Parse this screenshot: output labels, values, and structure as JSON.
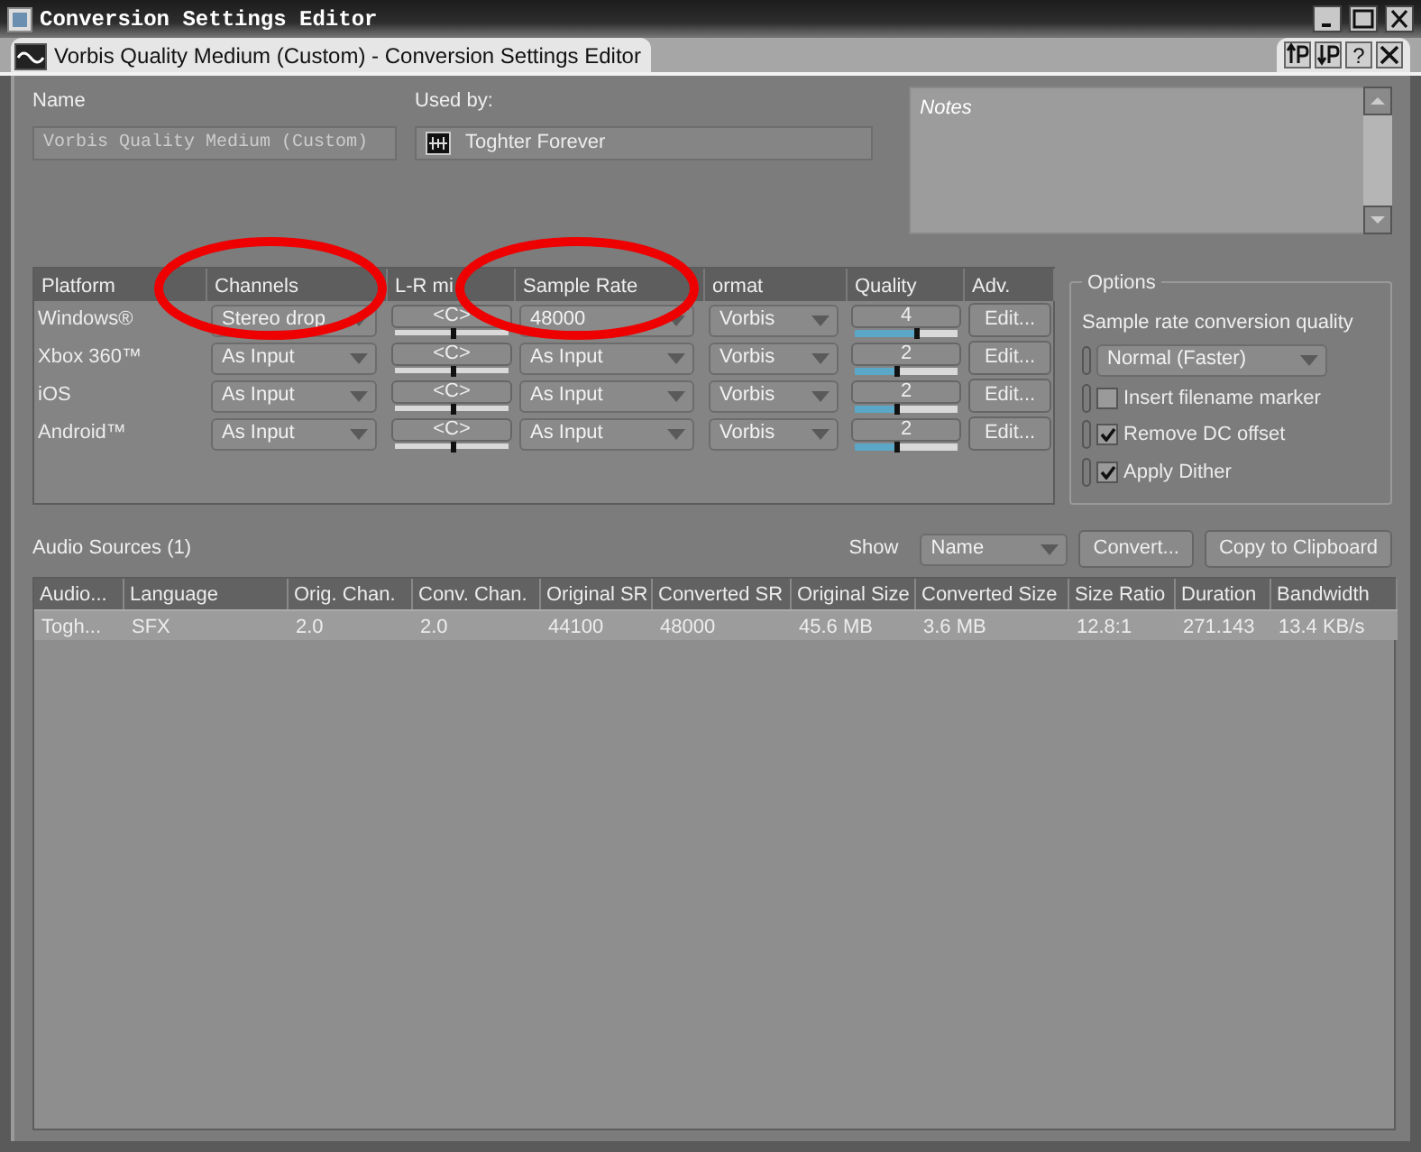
{
  "window": {
    "title": "Conversion Settings Editor"
  },
  "tab": {
    "title": "Vorbis Quality Medium (Custom) - Conversion Settings Editor",
    "help": "?"
  },
  "name": {
    "label": "Name",
    "value": "Vorbis Quality Medium (Custom)",
    "disabled": true
  },
  "used_by": {
    "label": "Used by:",
    "value": "Toghter Forever"
  },
  "notes": {
    "placeholder": "Notes"
  },
  "platforms": {
    "columns": [
      "Platform",
      "Channels",
      "L-R mi",
      "Sample Rate",
      "ormat",
      "Quality",
      "Adv."
    ],
    "rows": [
      {
        "platform": "Windows®",
        "channels": "Stereo drop",
        "mix": "<C>",
        "sample_rate": "48000",
        "format": "Vorbis",
        "quality": "4",
        "level": 0.6,
        "adv": "Edit..."
      },
      {
        "platform": "Xbox 360™",
        "channels": "As Input",
        "mix": "<C>",
        "sample_rate": "As Input",
        "format": "Vorbis",
        "quality": "2",
        "level": 0.4,
        "adv": "Edit..."
      },
      {
        "platform": "iOS",
        "channels": "As Input",
        "mix": "<C>",
        "sample_rate": "As Input",
        "format": "Vorbis",
        "quality": "2",
        "level": 0.4,
        "adv": "Edit..."
      },
      {
        "platform": "Android™",
        "channels": "As Input",
        "mix": "<C>",
        "sample_rate": "As Input",
        "format": "Vorbis",
        "quality": "2",
        "level": 0.4,
        "adv": "Edit..."
      }
    ]
  },
  "options": {
    "title": "Options",
    "sr_label": "Sample rate conversion quality",
    "sr_value": "Normal (Faster)",
    "checkboxes": [
      {
        "label": "Insert filename marker",
        "checked": false
      },
      {
        "label": "Remove DC offset",
        "checked": true
      },
      {
        "label": "Apply Dither",
        "checked": true
      }
    ]
  },
  "sources": {
    "title": "Audio Sources (1)",
    "show_label": "Show",
    "show_value": "Name",
    "buttons": [
      "Convert...",
      "Copy to Clipboard"
    ],
    "columns": [
      "Audio...",
      "Language",
      "Orig. Chan.",
      "Conv. Chan.",
      "Original SR",
      "Converted SR",
      "Original Size",
      "Converted Size",
      "Size Ratio",
      "Duration",
      "Bandwidth"
    ],
    "rows": [
      [
        "Togh...",
        "SFX",
        "2.0",
        "2.0",
        "44100",
        "48000",
        "45.6 MB",
        "3.6 MB",
        "12.8:1",
        "271.143",
        "13.4 KB/s"
      ]
    ]
  }
}
